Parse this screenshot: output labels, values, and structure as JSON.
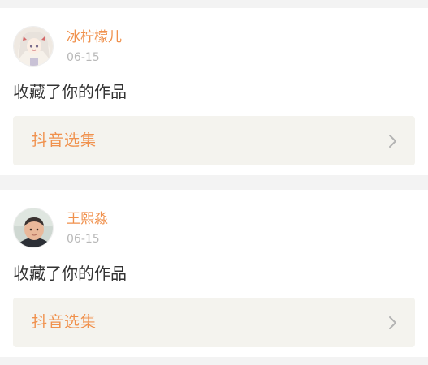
{
  "notifications": [
    {
      "username": "冰柠檬儿",
      "time": "06-15",
      "action": "收藏了你的作品",
      "collection_label": "抖音选集",
      "avatar_icon": "anime-girl-avatar"
    },
    {
      "username": "王熙淼",
      "time": "06-15",
      "action": "收藏了你的作品",
      "collection_label": "抖音选集",
      "avatar_icon": "child-photo-avatar"
    }
  ],
  "colors": {
    "accent": "#f0914d",
    "muted": "#b8b8b8",
    "text": "#333333",
    "bar_bg": "#f4f3ee",
    "page_bg": "#f3f3f3"
  }
}
